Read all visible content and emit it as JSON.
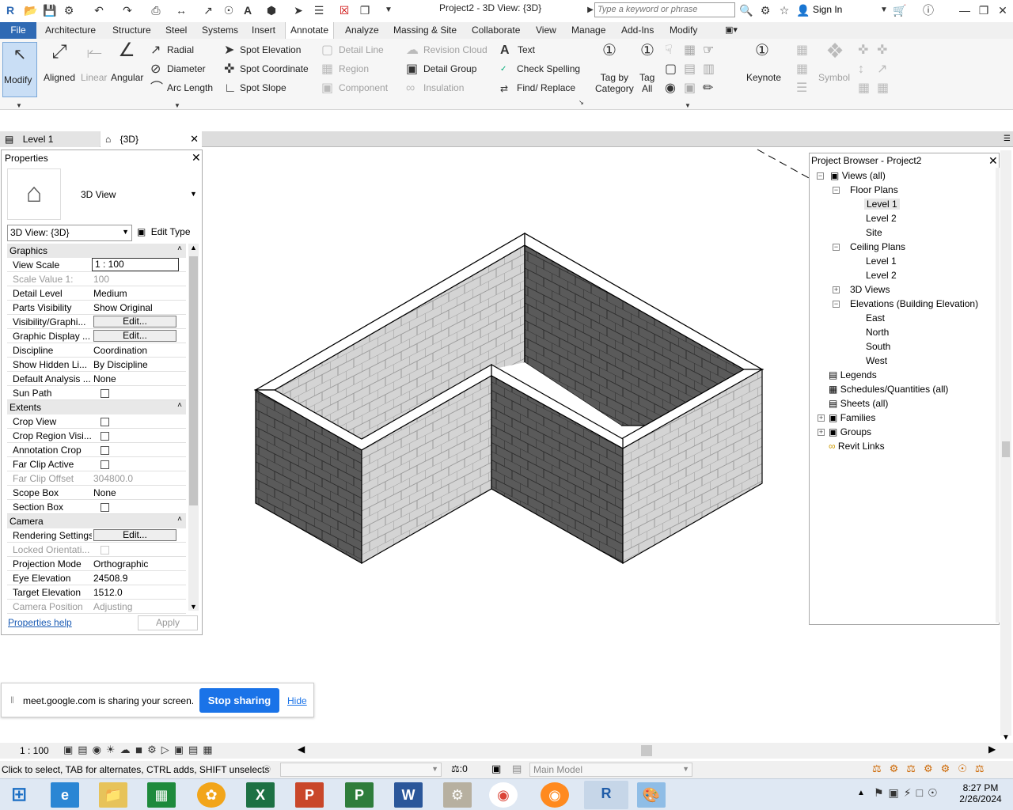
{
  "app": {
    "title": "Project2 - 3D View: {3D}",
    "search_placeholder": "Type a keyword or phrase",
    "sign_in": "Sign In"
  },
  "menu": [
    "File",
    "Architecture",
    "Structure",
    "Steel",
    "Systems",
    "Insert",
    "Annotate",
    "Analyze",
    "Massing & Site",
    "Collaborate",
    "View",
    "Manage",
    "Add-Ins",
    "Modify"
  ],
  "ribbon": {
    "modify": "Modify",
    "aligned": "Aligned",
    "linear": "Linear",
    "angular": "Angular",
    "radial": "Radial",
    "diameter": "Diameter",
    "arc_length": "Arc  Length",
    "spot_elevation": "Spot  Elevation",
    "spot_coordinate": "Spot  Coordinate",
    "spot_slope": "Spot  Slope",
    "detail_line": "Detail  Line",
    "region": "Region",
    "component": "Component",
    "revision_cloud": "Revision  Cloud",
    "detail_group": "Detail  Group",
    "insulation": "Insulation",
    "text": "Text",
    "check_spelling": "Check  Spelling",
    "find_replace": "Find/  Replace",
    "tag_by_category": "Tag by\nCategory",
    "tag_all": "Tag\nAll",
    "keynote": "Keynote",
    "symbol": "Symbol"
  },
  "view_tabs": {
    "level1": "Level 1",
    "3d": "{3D}"
  },
  "properties": {
    "title": "Properties",
    "type_name": "3D View",
    "selector": "3D View: {3D}",
    "edit_type": "Edit Type",
    "groups": {
      "graphics": "Graphics",
      "extents": "Extents",
      "camera": "Camera"
    },
    "graphics": [
      {
        "name": "View Scale",
        "value": "1 : 100"
      },
      {
        "name": "Scale Value    1:",
        "value": "100"
      },
      {
        "name": "Detail Level",
        "value": "Medium"
      },
      {
        "name": "Parts Visibility",
        "value": "Show Original"
      },
      {
        "name": "Visibility/Graphi...",
        "value": "Edit..."
      },
      {
        "name": "Graphic Display ...",
        "value": "Edit..."
      },
      {
        "name": "Discipline",
        "value": "Coordination"
      },
      {
        "name": "Show Hidden Li...",
        "value": "By Discipline"
      },
      {
        "name": "Default Analysis ...",
        "value": "None"
      },
      {
        "name": "Sun Path",
        "value": ""
      }
    ],
    "extents": [
      {
        "name": "Crop View",
        "value": ""
      },
      {
        "name": "Crop Region Visi...",
        "value": ""
      },
      {
        "name": "Annotation Crop",
        "value": ""
      },
      {
        "name": "Far Clip Active",
        "value": ""
      },
      {
        "name": "Far Clip Offset",
        "value": "304800.0"
      },
      {
        "name": "Scope Box",
        "value": "None"
      },
      {
        "name": "Section Box",
        "value": ""
      }
    ],
    "camera": [
      {
        "name": "Rendering Settings",
        "value": "Edit..."
      },
      {
        "name": "Locked Orientati...",
        "value": ""
      },
      {
        "name": "Projection Mode",
        "value": "Orthographic"
      },
      {
        "name": "Eye Elevation",
        "value": "24508.9"
      },
      {
        "name": "Target Elevation",
        "value": "1512.0"
      },
      {
        "name": "Camera Position",
        "value": "Adjusting"
      }
    ],
    "help": "Properties help",
    "apply": "Apply"
  },
  "browser": {
    "title": "Project Browser - Project2",
    "views_all": "Views (all)",
    "floor_plans": "Floor Plans",
    "fp_level1": "Level 1",
    "fp_level2": "Level 2",
    "fp_site": "Site",
    "ceiling_plans": "Ceiling Plans",
    "cp_level1": "Level 1",
    "cp_level2": "Level 2",
    "views3d": "3D Views",
    "elevations": "Elevations (Building Elevation)",
    "east": "East",
    "north": "North",
    "south": "South",
    "west": "West",
    "legends": "Legends",
    "schedules": "Schedules/Quantities (all)",
    "sheets": "Sheets (all)",
    "families": "Families",
    "groups": "Groups",
    "revit_links": "Revit Links"
  },
  "share": {
    "message": "meet.google.com is sharing your screen.",
    "stop": "Stop sharing",
    "hide": "Hide"
  },
  "status": {
    "scale": "1 : 100",
    "hint": "Click to select, TAB for alternates, CTRL adds, SHIFT unselects",
    "count": ":0",
    "model": "Main Model"
  },
  "clock": {
    "time": "8:27 PM",
    "date": "2/26/2024"
  },
  "colors": {
    "accent": "#2f6ab4",
    "brick_dark": "#555555",
    "brick_light": "#d7d7d7"
  }
}
